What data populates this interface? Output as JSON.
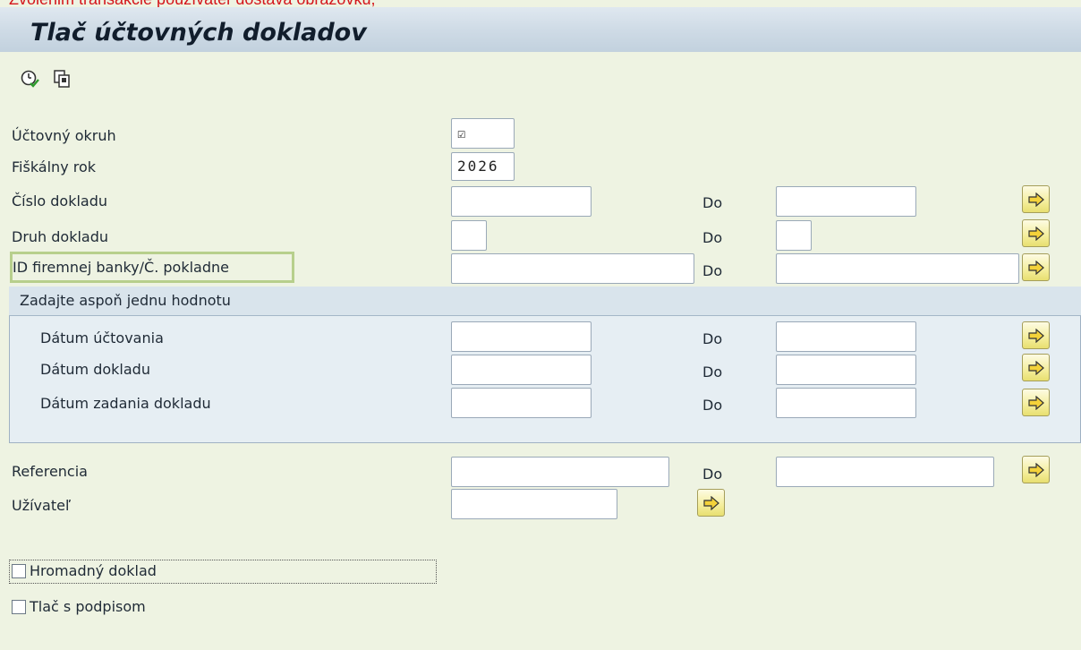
{
  "top_note": "Zvolenim transakcie používateľ dostáva obrazovku,",
  "title": "Tlač účtovných dokladov",
  "toolbar": {
    "execute_icon": "execute-clock-icon",
    "variant_icon": "get-variant-icon"
  },
  "fields": {
    "company_code": {
      "label": "Účtovný okruh",
      "value": "☑"
    },
    "fiscal_year": {
      "label": "Fiškálny rok",
      "value": "2026"
    },
    "doc_number": {
      "label": "Číslo dokladu",
      "to": "Do"
    },
    "doc_type": {
      "label": "Druh dokladu",
      "to": "Do"
    },
    "house_bank": {
      "label": "ID firemnej banky/Č. pokladne",
      "to": "Do"
    }
  },
  "group": {
    "title": "Zadajte aspoň jednu hodnotu",
    "posting_date": {
      "label": "Dátum účtovania",
      "to": "Do"
    },
    "doc_date": {
      "label": "Dátum dokladu",
      "to": "Do"
    },
    "entry_date": {
      "label": "Dátum zadania dokladu",
      "to": "Do"
    }
  },
  "reference": {
    "label": "Referencia",
    "to": "Do"
  },
  "user": {
    "label": "Užívateľ"
  },
  "checkboxes": {
    "mass_doc": "Hromadný doklad",
    "print_signature": "Tlač s podpisom"
  },
  "colors": {
    "background": "#eef3e2",
    "title_bar": "#cfdbe6",
    "select_button": "#f4ee9c",
    "note_text": "#d4161c"
  }
}
